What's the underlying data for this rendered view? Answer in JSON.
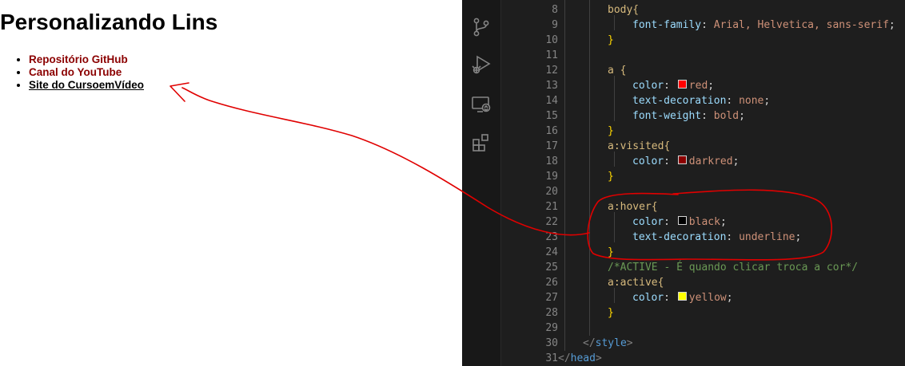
{
  "preview": {
    "title": "Personalizando Lins",
    "links": [
      {
        "label": "Repositório GitHub",
        "state": "visited"
      },
      {
        "label": "Canal do YouTube",
        "state": "visited"
      },
      {
        "label": "Site do CursoemVídeo",
        "state": "hover"
      }
    ]
  },
  "activity_bar": {
    "icons": [
      "source-control-icon",
      "run-debug-icon",
      "remote-explorer-icon",
      "extensions-icon"
    ]
  },
  "editor": {
    "line_numbers": [
      "8",
      "9",
      "10",
      "11",
      "12",
      "13",
      "14",
      "15",
      "16",
      "17",
      "18",
      "19",
      "20",
      "21",
      "22",
      "23",
      "24",
      "25",
      "26",
      "27",
      "28",
      "29",
      "30",
      "31"
    ],
    "lines": {
      "l8_sel": "body{",
      "l9_prop": "font-family",
      "l9_val": "Arial, Helvetica, sans-serif",
      "l10": "}",
      "l12_sel": "a {",
      "l13_prop": "color",
      "l13_val": "red",
      "l13_swatch": "#ff0000",
      "l14_prop": "text-decoration",
      "l14_val": "none",
      "l15_prop": "font-weight",
      "l15_val": "bold",
      "l16": "}",
      "l17_sel": "a:visited{",
      "l18_prop": "color",
      "l18_val": "darkred",
      "l18_swatch": "#8b0000",
      "l19": "}",
      "l21_sel": "a:hover{",
      "l22_prop": "color",
      "l22_val": "black",
      "l22_swatch": "#000000",
      "l23_prop": "text-decoration",
      "l23_val": "underline",
      "l24": "}",
      "l25_comment": "/*ACTIVE - É quando clicar troca a cor*/",
      "l26_sel": "a:active{",
      "l27_prop": "color",
      "l27_val": "yellow",
      "l27_swatch": "#ffff00",
      "l28": "}",
      "l30_tag": "style",
      "l31_tag": "head"
    }
  },
  "annotation": {
    "color": "#e00000"
  }
}
